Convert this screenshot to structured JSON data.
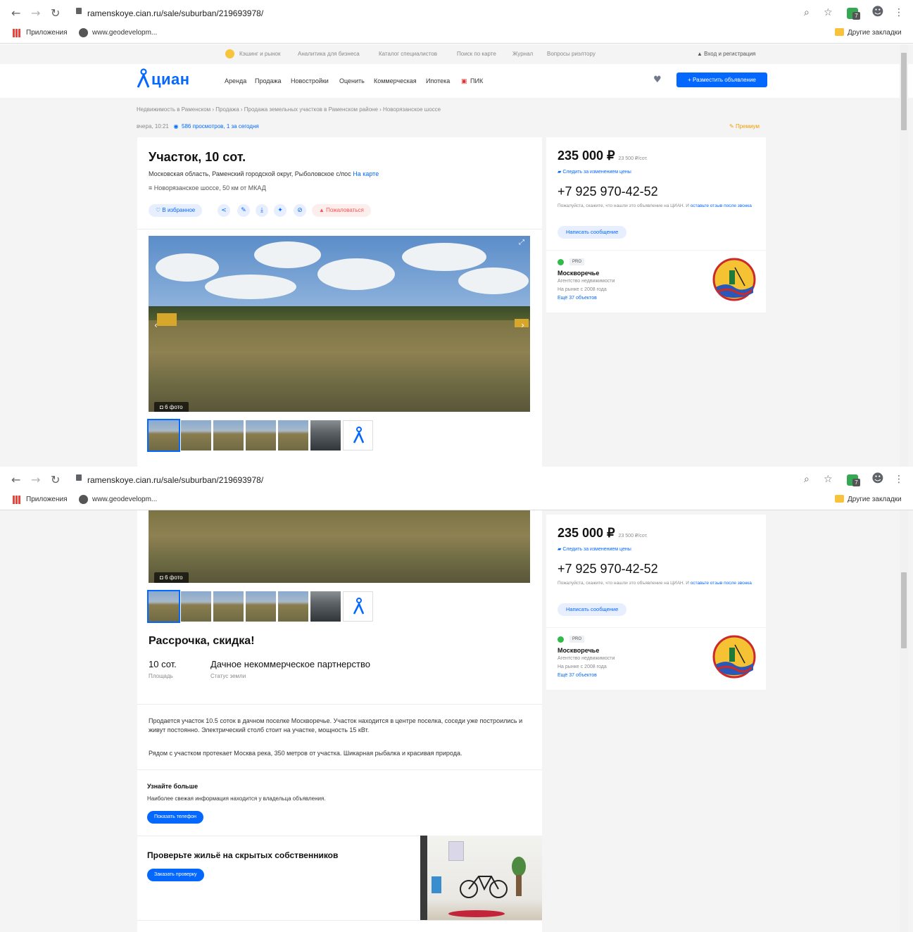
{
  "browser": {
    "url": "ramenskoye.cian.ru/sale/suburban/219693978/",
    "bookmark_apps": "Приложения",
    "bookmark_site": "www.geodevelopm...",
    "bookmark_other": "Другие закладки",
    "ext_badge": "7"
  },
  "topnav": {
    "links": [
      "Кэшинг и рынок",
      "Аналитика для бизнеса",
      "Каталог специалистов",
      "Поиск по карте",
      "Журнал",
      "Вопросы риэлтору"
    ],
    "login": "Вход и регистрация"
  },
  "header": {
    "logo": "циан",
    "menu": [
      "Аренда",
      "Продажа",
      "Новостройки",
      "Оценить",
      "Коммерческая",
      "Ипотека",
      "ПИК"
    ],
    "post_button": "+ Разместить объявление"
  },
  "breadcrumbs": "Недвижимость в Раменском  ›  Продажа  ›  Продажа земельных участков в Раменском районе  ›  Новорязанское шоссе",
  "meta": {
    "date": "вчера, 10:21",
    "views": "586 просмотров, 1 за сегодня",
    "premium": "Премиум"
  },
  "listing": {
    "title": "Участок, 10 сот.",
    "address": "Московская область, Раменский городской округ, Рыболовское с/пос",
    "map_link": "На карте",
    "highway": "Новорязанское шоссе, 50 км от МКАД",
    "favorite": "В избранное",
    "complain": "Пожаловаться",
    "photo_count": "6 фото"
  },
  "sidebar": {
    "price": "235 000 ₽",
    "price_per": "23 500 ₽/сот.",
    "watch_price": "Следить за изменением цены",
    "phone": "+7 925 970-42-52",
    "note": "Пожалуйста, скажите, что нашли это объявление на ЦИАН. И",
    "note_link": "оставьте отзыв после звонка",
    "message_button": "Написать сообщение",
    "pro": "PRO",
    "agent_name": "Москворечье",
    "agent_type": "Агентство недвижимости",
    "agent_since": "На рынке с 2008 года",
    "agent_more": "Ещё 37 объектов"
  },
  "details": {
    "promo_title": "Рассрочка, скидка!",
    "area_value": "10 сот.",
    "area_label": "Площадь",
    "status_value": "Дачное некоммерческое партнерство",
    "status_label": "Статус земли",
    "description_1": "Продается участок 10.5 соток в дачном поселке Москворечье. Участок находится в центре поселка, соседи уже построились и живут постоянно. Электрический столб стоит на участке, мощность 15 кВт.",
    "description_2": "Рядом с участком протекает Москва река, 350 метров от участка. Шикарная рыбалка и красивая природа.",
    "know_title": "Узнайте больше",
    "know_text": "Наиболее свежая информация находится у владельца объявления.",
    "show_phone": "Показать телефон",
    "check_title": "Проверьте жильё на скрытых собственников",
    "order_check": "Заказать проверку"
  },
  "colors": {
    "brand_blue": "#0468ff",
    "premium_orange": "#f29d00",
    "complain_red": "#ff5050",
    "pro_green": "#2fbb48"
  }
}
